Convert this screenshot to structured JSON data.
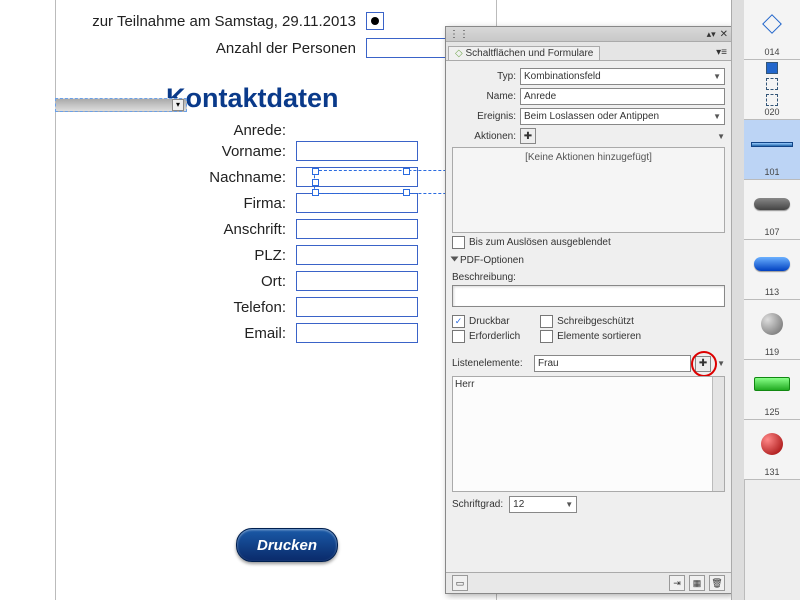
{
  "doc": {
    "line1": "zur Teilnahme am Samstag, 29.11.2013",
    "line2": "Anzahl der Personen",
    "heading": "Kontaktdaten",
    "fields": {
      "anrede": "Anrede:",
      "vorname": "Vorname:",
      "nachname": "Nachname:",
      "firma": "Firma:",
      "anschrift": "Anschrift:",
      "plz": "PLZ:",
      "ort": "Ort:",
      "telefon": "Telefon:",
      "email": "Email:"
    },
    "print": "Drucken"
  },
  "panel": {
    "title": "Schaltflächen und Formulare",
    "labels": {
      "typ": "Typ:",
      "name": "Name:",
      "ereignis": "Ereignis:",
      "aktionen": "Aktionen:",
      "none_added": "[Keine Aktionen hinzugefügt]",
      "hide_until": "Bis zum Auslösen ausgeblendet",
      "pdf_opts": "PDF-Optionen",
      "beschreibung": "Beschreibung:",
      "druckbar": "Druckbar",
      "schreib": "Schreibgeschützt",
      "erforderlich": "Erforderlich",
      "sortieren": "Elemente sortieren",
      "listen": "Listenelemente:",
      "schriftgrad": "Schriftgrad:"
    },
    "values": {
      "typ": "Kombinationsfeld",
      "name": "Anrede",
      "ereignis": "Beim Loslassen oder Antippen",
      "list_input": "Frau",
      "list_item1": "Herr",
      "schriftgrad": "12"
    },
    "checks": {
      "druckbar": true,
      "schreib": false,
      "erforderlich": false,
      "sortieren": false,
      "hide_until": false
    }
  },
  "lib": {
    "items": [
      "014",
      "020",
      "101",
      "107",
      "113",
      "119",
      "125",
      "131"
    ]
  }
}
